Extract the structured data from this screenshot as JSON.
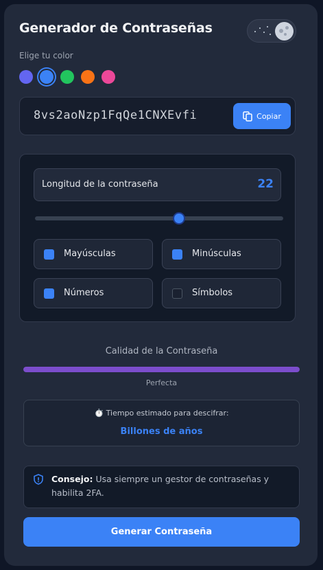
{
  "header": {
    "title": "Generador de Contraseñas"
  },
  "theme_toggle": {
    "mode": "dark"
  },
  "color_picker": {
    "label": "Elige tu color",
    "colors": [
      "#6366f1",
      "#3b82f6",
      "#22c55e",
      "#f97316",
      "#ec4899"
    ],
    "selected": 1
  },
  "password": {
    "value": "8vs2aoNzp1FqQe1CNXEvfi",
    "copy_label": "Copiar"
  },
  "options": {
    "length_label": "Longitud de la contraseña",
    "length_value": "22",
    "slider_fraction": 0.58,
    "checkboxes": [
      {
        "label": "Mayúsculas",
        "checked": true
      },
      {
        "label": "Minúsculas",
        "checked": true
      },
      {
        "label": "Números",
        "checked": true
      },
      {
        "label": "Símbolos",
        "checked": false
      }
    ]
  },
  "quality": {
    "title": "Calidad de la Contraseña",
    "level": "Perfecta",
    "fraction": 1.0,
    "color": "#7c4dcc"
  },
  "crack_time": {
    "label": "⏱️ Tiempo estimado para descifrar:",
    "value": "Billones de años"
  },
  "tip": {
    "label": "Consejo:",
    "text": "Usa siempre un gestor de contraseñas y habilita 2FA."
  },
  "generate_button": {
    "label": "Generar Contraseña"
  }
}
